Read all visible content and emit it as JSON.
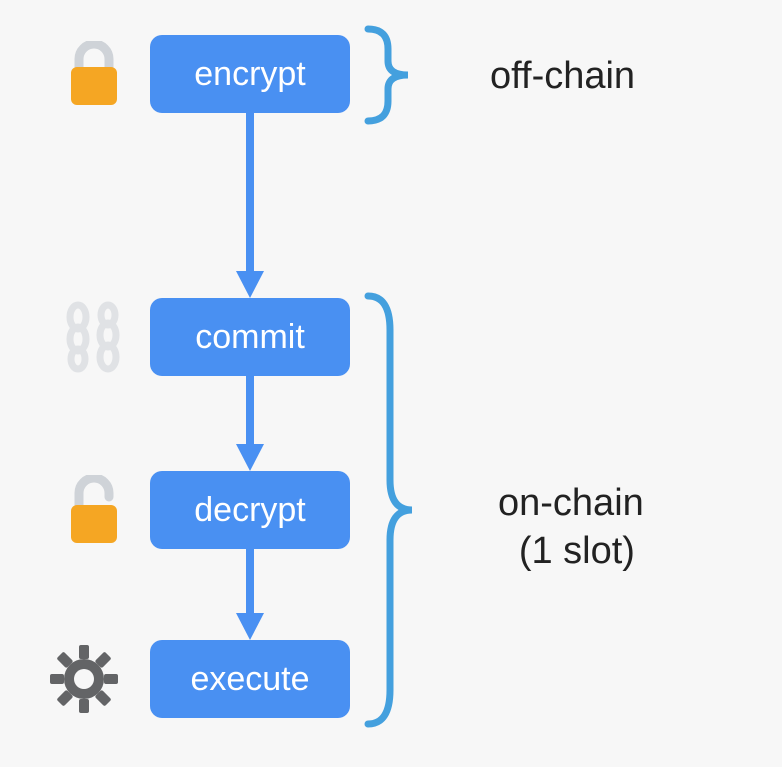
{
  "ui": {
    "bg": "#f7f7f7"
  },
  "colors": {
    "node_fill": "#4990f2",
    "text_on_node": "#ffffff",
    "arrow": "#4990f2",
    "brace": "#44a0de",
    "lock_body": "#f5a623",
    "lock_shackle": "#cfd3d8",
    "chain": "#e3e4e6",
    "gear": "#636466",
    "label": "#222222"
  },
  "nodes": {
    "encrypt": "encrypt",
    "commit": "commit",
    "decrypt": "decrypt",
    "execute": "execute"
  },
  "groups": {
    "offchain_label": "off-chain",
    "onchain_label_line1": "on-chain",
    "onchain_label_line2": "(1 slot)"
  },
  "icons": {
    "encrypt": "lock-closed-icon",
    "commit": "chain-icon",
    "decrypt": "lock-open-icon",
    "execute": "gear-icon"
  }
}
